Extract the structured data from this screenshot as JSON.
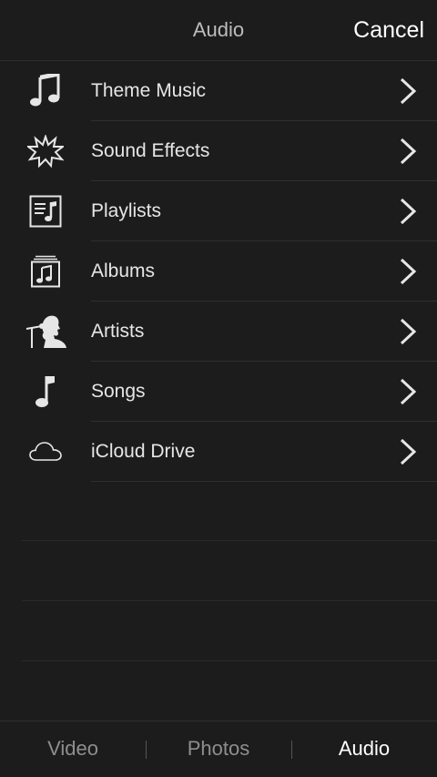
{
  "nav": {
    "title": "Audio",
    "cancel_label": "Cancel"
  },
  "items": [
    {
      "label": "Theme Music",
      "icon": "music-notes-icon"
    },
    {
      "label": "Sound Effects",
      "icon": "starburst-icon"
    },
    {
      "label": "Playlists",
      "icon": "playlist-icon"
    },
    {
      "label": "Albums",
      "icon": "album-stack-icon"
    },
    {
      "label": "Artists",
      "icon": "singer-microphone-icon"
    },
    {
      "label": "Songs",
      "icon": "music-note-icon"
    },
    {
      "label": "iCloud Drive",
      "icon": "cloud-icon"
    }
  ],
  "tabs": [
    {
      "label": "Video",
      "selected": false
    },
    {
      "label": "Photos",
      "selected": false
    },
    {
      "label": "Audio",
      "selected": true
    }
  ],
  "colors": {
    "background": "#1c1c1c",
    "separator": "#2f2f2f",
    "text": "#e6e6e6",
    "inactive_tab": "#8e8e8e",
    "active_tab": "#ffffff"
  }
}
